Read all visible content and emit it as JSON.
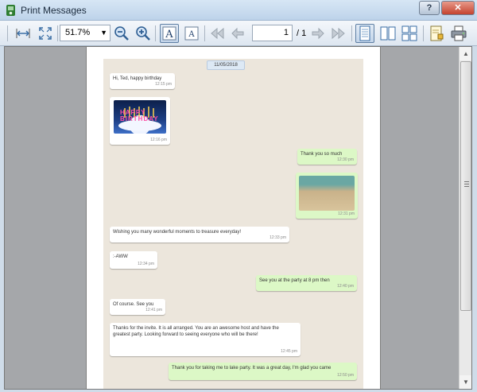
{
  "window": {
    "title": "Print Messages",
    "help_label": "?",
    "close_label": "✕"
  },
  "toolbar": {
    "zoom_value": "51.7%",
    "page_current": "1",
    "page_total": "/ 1",
    "icons": [
      "fit-width-icon",
      "fit-page-icon",
      "zoom-out-icon",
      "zoom-in-icon",
      "font-larger-icon",
      "font-smaller-icon",
      "first-page-icon",
      "previous-page-icon",
      "next-page-icon",
      "last-page-icon",
      "single-page-icon",
      "facing-pages-icon",
      "overview-icon",
      "page-setup-icon",
      "print-icon"
    ]
  },
  "chat": {
    "date": "11/05/2018",
    "messages": [
      {
        "dir": "in",
        "text": "Hi, Ted, happy birthday",
        "time": "12:15 pm"
      },
      {
        "dir": "in",
        "type": "image",
        "image_text": "HAPPY BIRTHDAY",
        "time": "12:16 pm"
      },
      {
        "dir": "out",
        "text": "Thank you so much",
        "time": "12:30 pm"
      },
      {
        "dir": "out",
        "type": "image",
        "time": "12:31 pm"
      },
      {
        "dir": "in",
        "text": "Wishing you many wonderful moments to treasure everyday!",
        "time": "12:33 pm"
      },
      {
        "dir": "in",
        "text": ":-AWW",
        "time": "12:34 pm"
      },
      {
        "dir": "out",
        "text": "See you at the party at 8 pm then",
        "time": "12:40 pm"
      },
      {
        "dir": "in",
        "text": "Of course. See you",
        "time": "12:41 pm"
      },
      {
        "dir": "in",
        "text": "Thanks for the invite. It is all arranged. You are an awesome host and have the greatest party. Looking forward to seeing everyone who will be there!",
        "time": "12:45 pm"
      },
      {
        "dir": "out",
        "text": "Thank you for taking me to lake party. It was a great day, I'm glad you came",
        "time": "12:50 pm"
      }
    ]
  },
  "colors": {
    "incoming": "#ffffff",
    "outgoing": "#dcf8c6",
    "chat_background": "#ece6dc",
    "viewer_background": "#a5a7aa"
  }
}
